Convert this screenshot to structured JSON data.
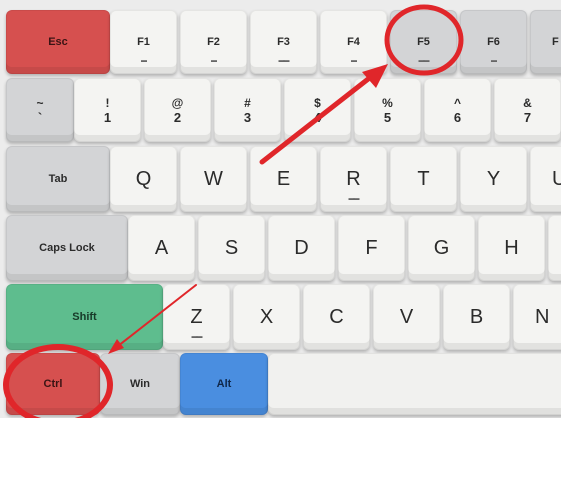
{
  "keyboard": {
    "row_function": [
      "Esc",
      "F1",
      "F2",
      "F3",
      "F4",
      "F5",
      "F6",
      "F"
    ],
    "row_number": [
      {
        "top": "~",
        "bottom": "`"
      },
      {
        "top": "!",
        "bottom": "1"
      },
      {
        "top": "@",
        "bottom": "2"
      },
      {
        "top": "#",
        "bottom": "3"
      },
      {
        "top": "$",
        "bottom": "4"
      },
      {
        "top": "%",
        "bottom": "5"
      },
      {
        "top": "^",
        "bottom": "6"
      },
      {
        "top": "&",
        "bottom": "7"
      }
    ],
    "row_qwerty": [
      "Tab",
      "Q",
      "W",
      "E",
      "R",
      "T",
      "Y",
      "U"
    ],
    "row_home": [
      "Caps Lock",
      "A",
      "S",
      "D",
      "F",
      "G",
      "H"
    ],
    "row_shift": [
      "Shift",
      "Z",
      "X",
      "C",
      "V",
      "B",
      "N"
    ],
    "row_bottom": [
      "Ctrl",
      "Win",
      "Alt"
    ]
  },
  "key_colors": {
    "esc": "#d6504f",
    "ctrl": "#d6504f",
    "shift": "#5ebd8e",
    "alt": "#4a8ee0",
    "modifier_gray": "#d3d4d6",
    "alpha_white": "#f4f4f2"
  },
  "annotations": {
    "highlight_color": "#e0262a",
    "highlighted_keys": [
      "F5",
      "Ctrl"
    ]
  }
}
